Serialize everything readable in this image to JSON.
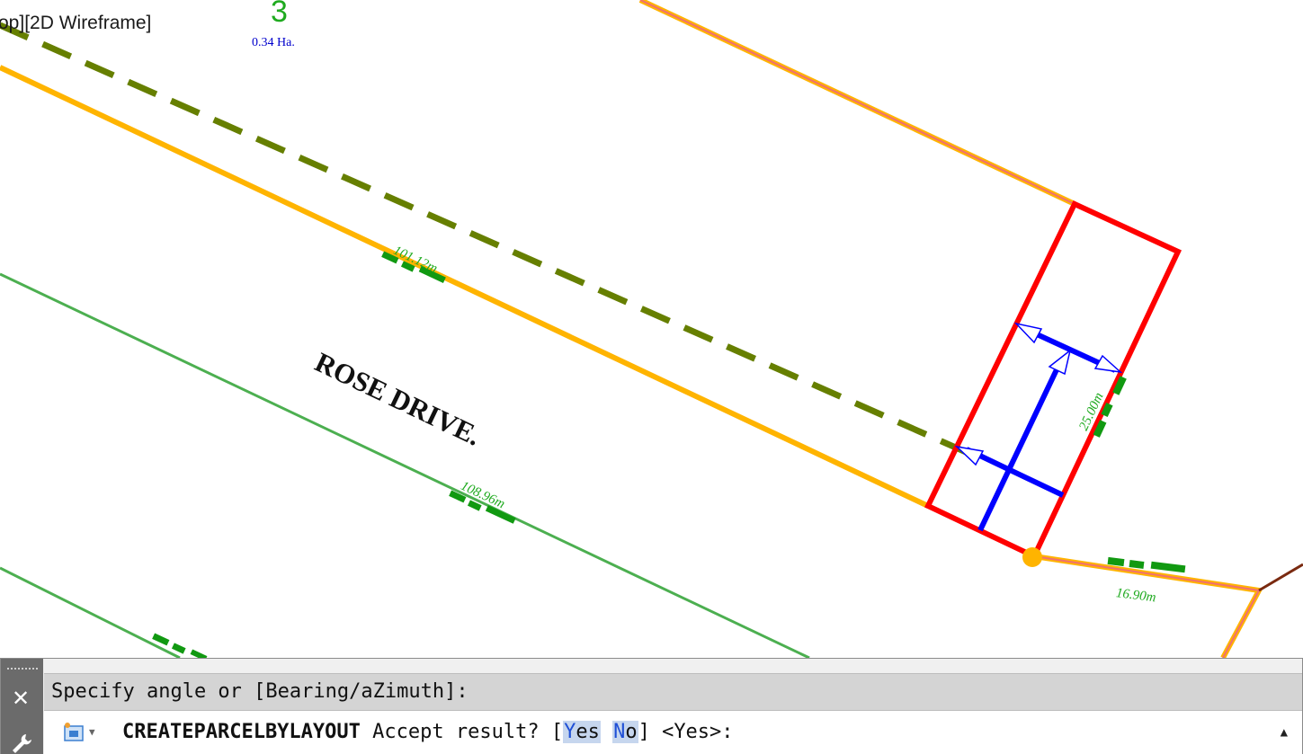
{
  "viewport": {
    "label": "op][2D Wireframe]"
  },
  "parcel": {
    "number": "3",
    "area": "0.34 Ha."
  },
  "street": {
    "name": "ROSE DRIVE."
  },
  "dimensions": {
    "d1": "101.12m",
    "d2": "108.96m",
    "d3": "25.00m",
    "d4": "16.90m"
  },
  "commandline": {
    "history": "Specify angle or [Bearing/aZimuth]:",
    "command": "CREATEPARCELBYLAYOUT",
    "prompt": "Accept result? [",
    "opt_yes_hotkey": "Y",
    "opt_yes_rest": "es",
    "opt_no_hotkey": "N",
    "opt_no_rest": "o",
    "prompt_end": "] <Yes>:",
    "close_icon": "close-icon",
    "settings_icon": "wrench-icon"
  },
  "colors": {
    "parcel_lot": "#ff0000",
    "arrows": "#0000ff",
    "dim_text": "#1faa1f",
    "area_text": "#0000cc",
    "row_line": "#ffb400",
    "dashed_line": "#667f00",
    "green_line": "#4caf50",
    "salmon_line": "#f07070"
  }
}
